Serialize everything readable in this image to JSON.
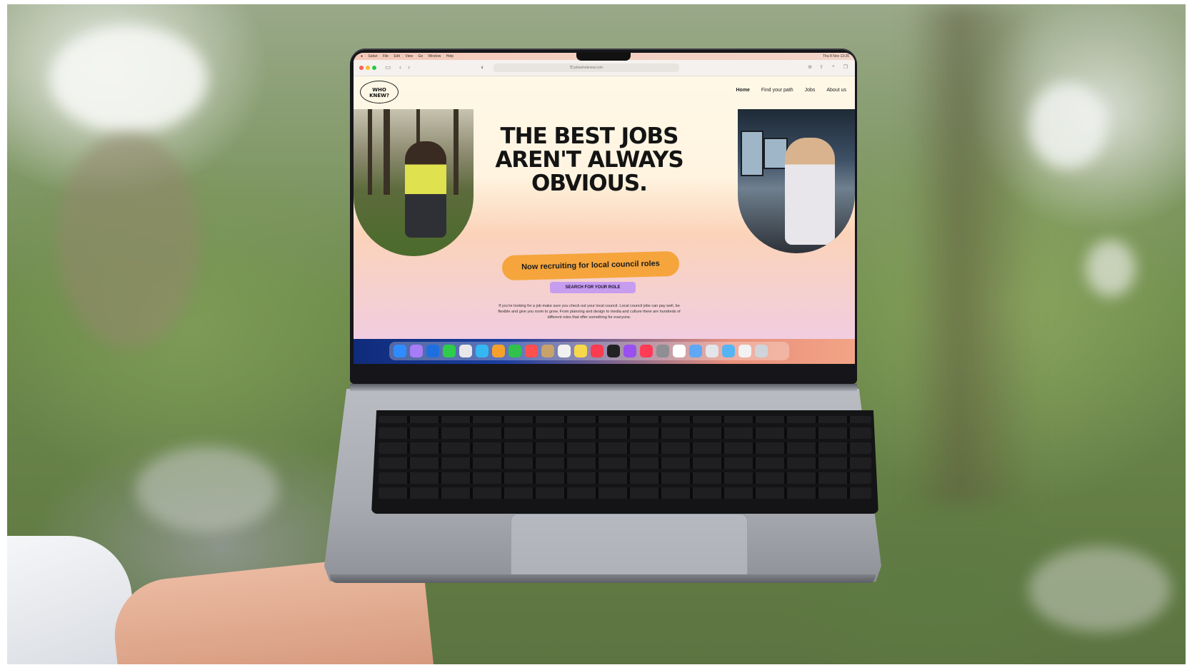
{
  "menubar": {
    "items": [
      "Safari",
      "File",
      "Edit",
      "View",
      "Go",
      "Window",
      "Help"
    ],
    "clock": "Thu 8 Nov 13:26"
  },
  "browser": {
    "url": "⚿ jobswhoknew.com"
  },
  "site": {
    "logo_line1": "WHO",
    "logo_line2": "KNEW?",
    "nav": [
      "Home",
      "Find your path",
      "Jobs",
      "About us"
    ],
    "headline_line1": "THE BEST JOBS",
    "headline_line2": "AREN'T ALWAYS",
    "headline_line3": "OBVIOUS.",
    "pill": "Now recruiting for local council roles",
    "cta": "SEARCH FOR YOUR ROLE",
    "description": "If you're looking for a job make sure you check out your local council. Local council jobs can pay well, be flexible and give you room to grow. From planning and design to media and culture there are hundreds of different roles that offer something for everyone."
  },
  "dock_colors": [
    "#2f8cff",
    "#a77cf7",
    "#1d6fe0",
    "#2ecc4a",
    "#e8e8ea",
    "#35b7f2",
    "#f7a12c",
    "#30c24b",
    "#ff4f4f",
    "#c8a26b",
    "#f1f1f1",
    "#f6d84a",
    "#fb3b4f",
    "#222222",
    "#9a4ff0",
    "#ff3b55",
    "#8e8e93",
    "#ffffff",
    "#5fa8f5",
    "#e3e5ea",
    "#57b4f4",
    "#f2f2f2",
    "#cfd3da"
  ],
  "colors": {
    "pill": "#f5a53c",
    "cta": "#c79df0"
  }
}
